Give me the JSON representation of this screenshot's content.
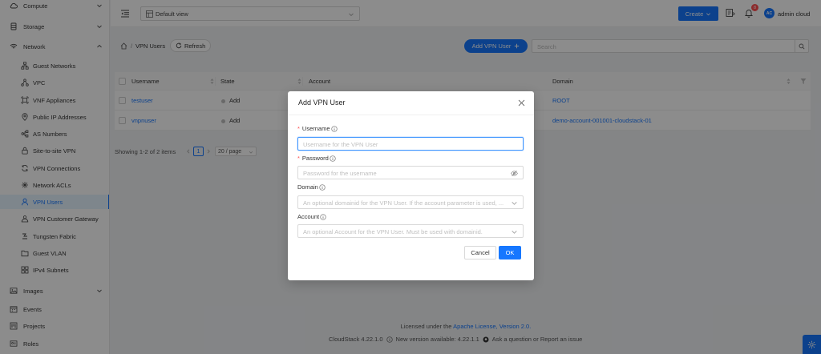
{
  "sidebar": {
    "items": [
      {
        "label": "Compute",
        "icon": "cloud-icon",
        "expandable": true
      },
      {
        "label": "Storage",
        "icon": "database-icon",
        "expandable": true
      },
      {
        "label": "Network",
        "icon": "wifi-icon",
        "expandable": true,
        "expanded": true
      },
      {
        "label": "Guest Networks",
        "icon": "apartment-icon"
      },
      {
        "label": "VPC",
        "icon": "deployment-icon"
      },
      {
        "label": "VNF Appliances",
        "icon": "gateway-icon"
      },
      {
        "label": "Public IP Addresses",
        "icon": "environment-icon"
      },
      {
        "label": "AS Numbers",
        "icon": "partition-icon"
      },
      {
        "label": "Site-to-site VPN",
        "icon": "lock-icon"
      },
      {
        "label": "VPN Connections",
        "icon": "sync-icon"
      },
      {
        "label": "Network ACLs",
        "icon": "acl-icon"
      },
      {
        "label": "VPN Users",
        "icon": "user-icon",
        "active": true
      },
      {
        "label": "VPN Customer Gateway",
        "icon": "customer-gateway-icon"
      },
      {
        "label": "Tungsten Fabric",
        "icon": "fabric-icon"
      },
      {
        "label": "Guest VLAN",
        "icon": "folder-icon"
      },
      {
        "label": "IPv4 Subnets",
        "icon": "subnet-icon"
      },
      {
        "label": "Images",
        "icon": "picture-icon",
        "expandable": true
      },
      {
        "label": "Events",
        "icon": "schedule-icon"
      },
      {
        "label": "Projects",
        "icon": "project-icon"
      },
      {
        "label": "Roles",
        "icon": "idcard-icon"
      }
    ]
  },
  "header": {
    "view_select": "Default view",
    "create_label": "Create",
    "notification_count": "8",
    "avatar_initials": "AC",
    "user_name": "admin cloud"
  },
  "toolbar": {
    "breadcrumb_sep": "/",
    "breadcrumb_current": "VPN Users",
    "refresh_label": "Refresh",
    "add_label": "Add VPN User",
    "search_placeholder": "Search"
  },
  "table": {
    "columns": [
      "Username",
      "State",
      "Account",
      "Domain"
    ],
    "rows": [
      {
        "username": "testuser",
        "state": "Add",
        "domain": "ROOT"
      },
      {
        "username": "vnpnuser",
        "state": "Add",
        "domain": "demo-account-001001-cloudstack-01"
      }
    ]
  },
  "pagination": {
    "summary": "Showing 1-2 of 2 items",
    "current_page": "1",
    "page_size": "20 / page"
  },
  "footer": {
    "license_prefix": "Licensed under the",
    "license_link": "Apache License, Version 2.0.",
    "version": "CloudStack 4.22.1.0",
    "new_version": "New version available: 4.22.1.1",
    "ask": "Ask a question or Report an issue"
  },
  "modal": {
    "title": "Add VPN User",
    "username_label": "Username",
    "username_placeholder": "Username for the VPN User",
    "password_label": "Password",
    "password_placeholder": "Password for the username",
    "domain_label": "Domain",
    "domain_placeholder": "An optional domainid for the VPN User. If the account parameter is used, ...",
    "account_label": "Account",
    "account_placeholder": "An optional Account for the VPN User. Must be used with domainid.",
    "cancel_label": "Cancel",
    "ok_label": "OK"
  },
  "colors": {
    "primary": "#1677ff",
    "danger": "#ff4d4f",
    "overlay": "rgba(0,0,0,0.45)"
  }
}
